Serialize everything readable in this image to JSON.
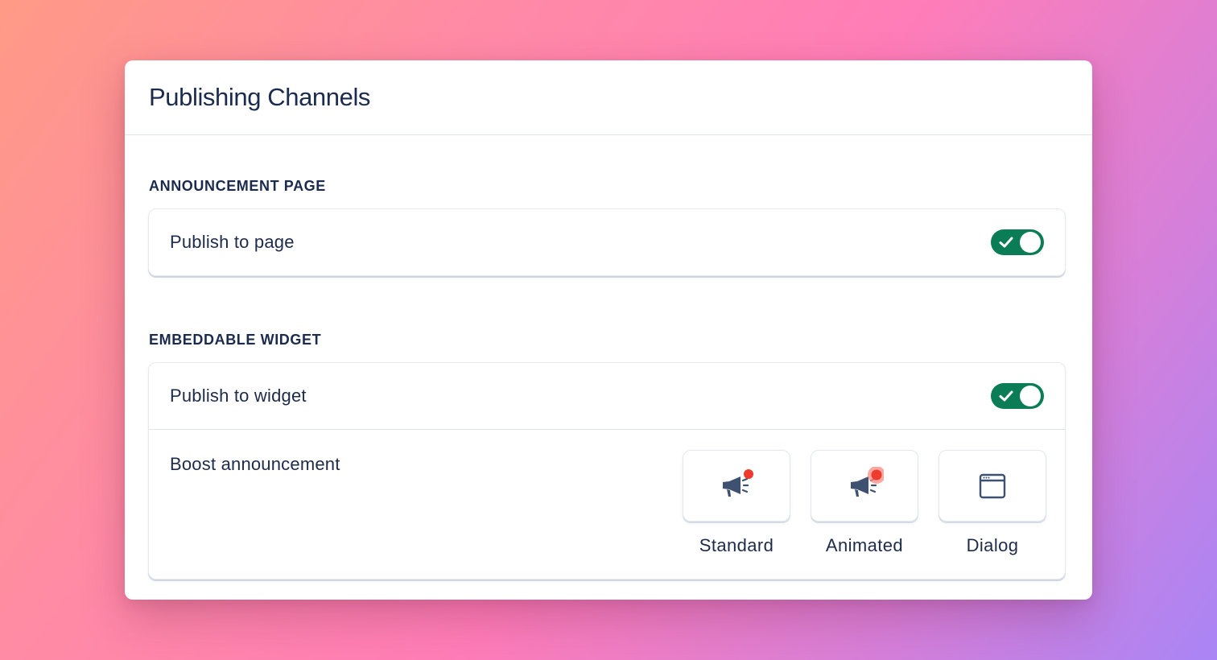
{
  "window": {
    "title": "Publishing Channels"
  },
  "sections": {
    "announcement_page": {
      "label": "ANNOUNCEMENT PAGE",
      "publish_label": "Publish to page",
      "publish_enabled": true
    },
    "embeddable_widget": {
      "label": "EMBEDDABLE WIDGET",
      "publish_label": "Publish to widget",
      "publish_enabled": true,
      "boost_label": "Boost announcement",
      "boost_options": [
        {
          "label": "Standard",
          "icon": "megaphone-dot-icon"
        },
        {
          "label": "Animated",
          "icon": "megaphone-pulse-icon"
        },
        {
          "label": "Dialog",
          "icon": "browser-window-icon"
        }
      ]
    }
  },
  "colors": {
    "toggle_on": "#0b7d56",
    "accent_dot": "#ef3b2d",
    "icon": "#3e5170",
    "text": "#1d2b4a"
  }
}
